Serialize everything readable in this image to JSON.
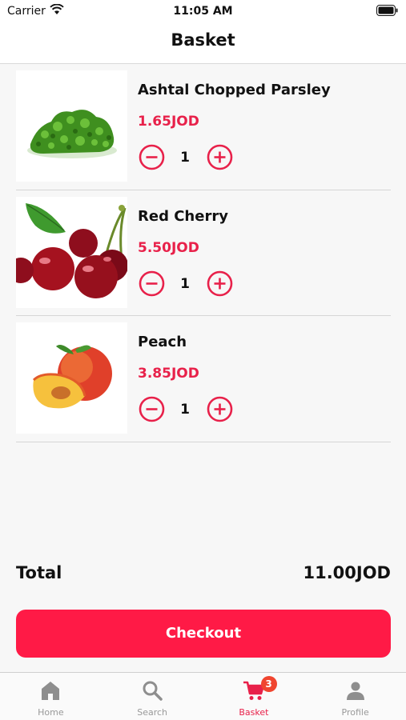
{
  "status_bar": {
    "carrier": "Carrier",
    "time": "11:05 AM"
  },
  "header": {
    "title": "Basket"
  },
  "items": [
    {
      "name": "Ashtal Chopped Parsley",
      "price": "1.65JOD",
      "quantity": "1",
      "image": "parsley-image"
    },
    {
      "name": "Red Cherry",
      "price": "5.50JOD",
      "quantity": "1",
      "image": "cherry-image"
    },
    {
      "name": "Peach",
      "price": "3.85JOD",
      "quantity": "1",
      "image": "peach-image"
    }
  ],
  "summary": {
    "total_label": "Total",
    "total_value": "11.00JOD"
  },
  "checkout": {
    "label": "Checkout"
  },
  "tabs": [
    {
      "label": "Home",
      "icon": "home-icon"
    },
    {
      "label": "Search",
      "icon": "search-icon"
    },
    {
      "label": "Basket",
      "icon": "cart-icon",
      "badge": "3",
      "active": true
    },
    {
      "label": "Profile",
      "icon": "profile-icon"
    }
  ],
  "colors": {
    "accent": "#e8214a",
    "button": "#ff1a46",
    "badge": "#f0452f"
  }
}
